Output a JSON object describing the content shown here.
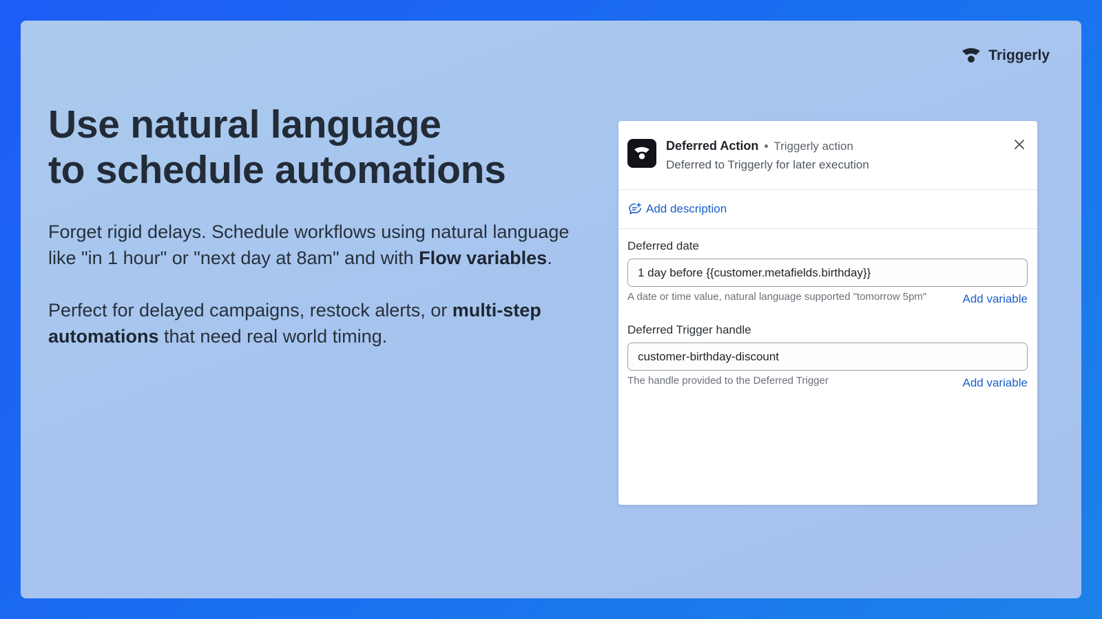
{
  "brand": {
    "name": "Triggerly"
  },
  "headline": {
    "line1": "Use natural language",
    "line2": "to schedule automations"
  },
  "paragraph1": {
    "text": "Forget rigid delays. Schedule workflows using natural language like \"in 1 hour\" or \"next day at 8am\" and with ",
    "bold": "Flow variables",
    "end": "."
  },
  "paragraph2": {
    "text": "Perfect for delayed campaigns, restock alerts, or ",
    "bold": "multi-step automations",
    "end": " that need real world timing."
  },
  "panel": {
    "title": "Deferred Action",
    "subtitle": "Triggerly action",
    "description": "Deferred to Triggerly for later execution",
    "add_description": "Add description",
    "fields": [
      {
        "label": "Deferred date",
        "value": "1 day before {{customer.metafields.birthday}}",
        "help": "A date or time value, natural language supported \"tomorrow 5pm\"",
        "add_variable": "Add variable"
      },
      {
        "label": "Deferred Trigger handle",
        "value": "customer-birthday-discount",
        "help": "The handle provided to the Deferred Trigger",
        "add_variable": "Add variable"
      }
    ]
  },
  "icons": {
    "brand": "triggerly-logo-icon",
    "app": "triggerly-app-icon",
    "close": "close-icon",
    "add_description": "comment-add-icon"
  },
  "colors": {
    "accent_link": "#1a5fc7",
    "background_blue": "#1d5cf5",
    "app_icon_bg": "#111318"
  }
}
